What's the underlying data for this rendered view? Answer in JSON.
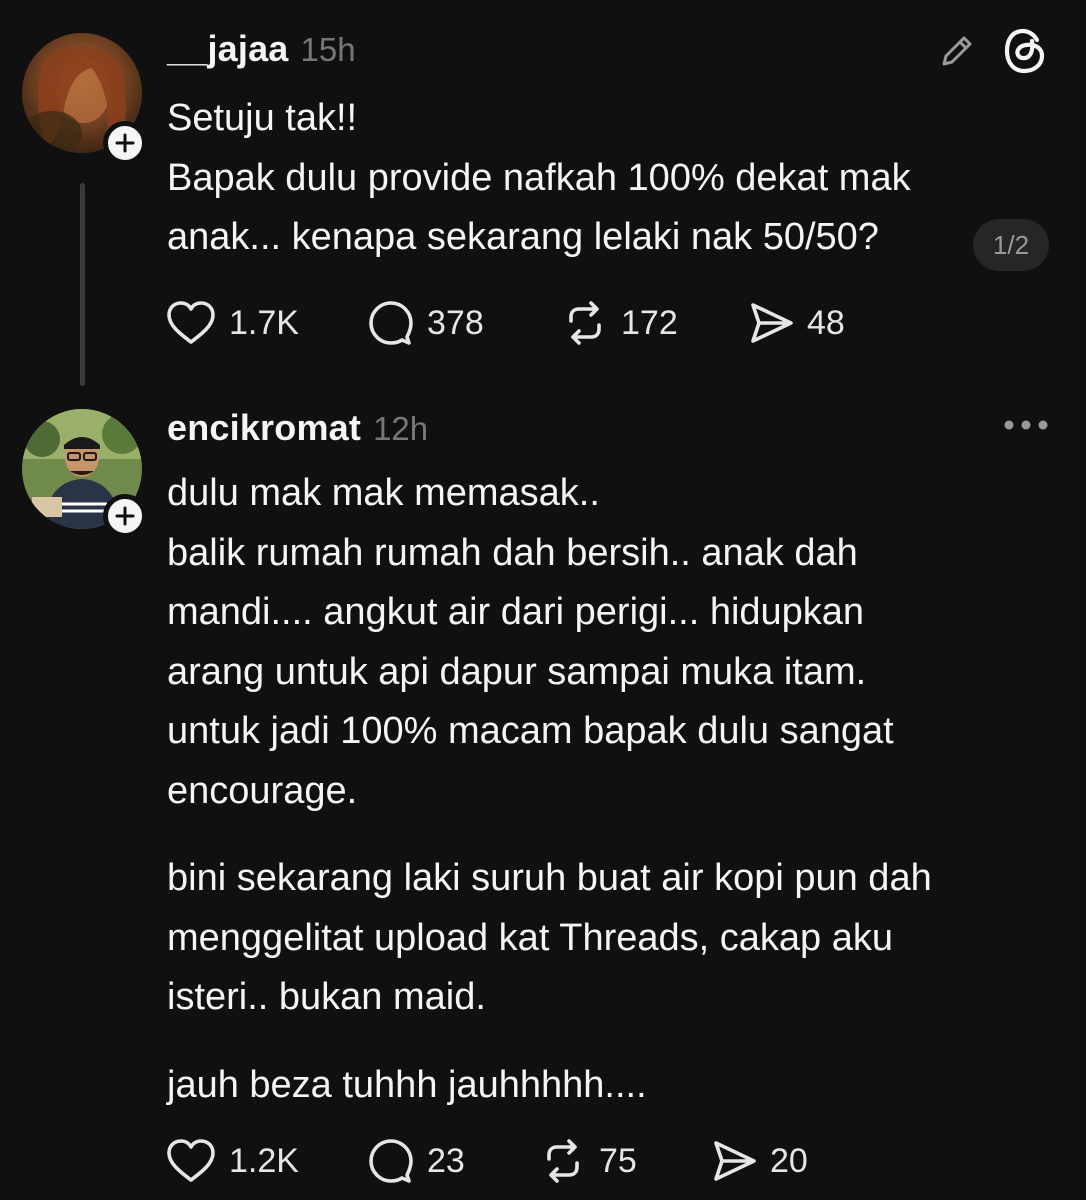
{
  "posts": [
    {
      "username": "__jajaa",
      "time": "15h",
      "lines": [
        "Setuju tak!!",
        "Bapak dulu provide nafkah 100% dekat mak",
        "anak... kenapa sekarang lelaki nak 50/50?"
      ],
      "page_indicator": "1/2",
      "stats": {
        "likes": "1.7K",
        "replies": "378",
        "reposts": "172",
        "shares": "48"
      }
    },
    {
      "username": "encikromat",
      "time": "12h",
      "paragraphs": [
        [
          "dulu mak mak memasak..",
          "balik rumah rumah dah bersih.. anak dah",
          "mandi.... angkut air dari perigi... hidupkan",
          "arang untuk api dapur sampai muka itam.",
          "untuk jadi 100% macam bapak dulu sangat",
          "encourage."
        ],
        [
          "bini sekarang laki suruh buat air kopi pun dah",
          "menggelitat upload kat Threads, cakap aku",
          "isteri.. bukan maid."
        ],
        [
          "jauh beza tuhhh jauhhhhh...."
        ]
      ],
      "stats": {
        "likes": "1.2K",
        "replies": "23",
        "reposts": "75",
        "shares": "20"
      }
    }
  ],
  "icons": {
    "edit": "pencil-icon",
    "brand": "threads-logo-icon",
    "more": "more-options-icon",
    "like": "heart-icon",
    "reply": "comment-icon",
    "repost": "repost-icon",
    "share": "send-icon",
    "follow": "plus-icon"
  },
  "colors": {
    "background": "#101010",
    "text": "#f3f5f7",
    "muted": "#777777"
  }
}
